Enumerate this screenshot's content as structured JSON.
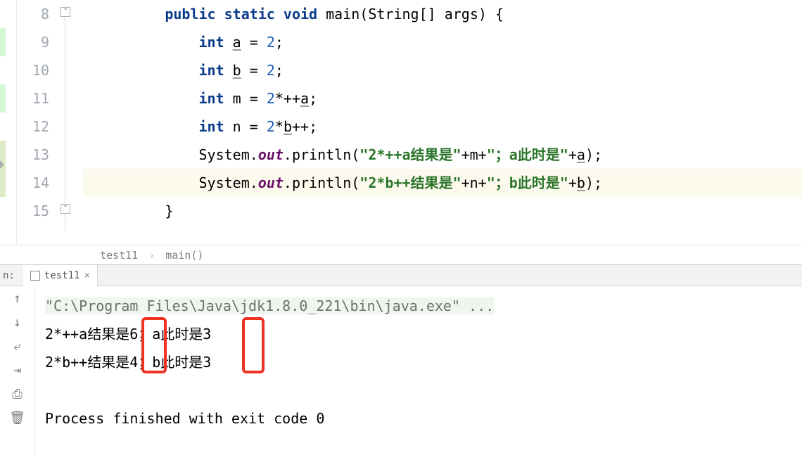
{
  "editor": {
    "lines": [
      {
        "n": 8,
        "indent": "        ",
        "tokens": [
          [
            "kw",
            "public"
          ],
          [
            "",
            " "
          ],
          [
            "kw",
            "static"
          ],
          [
            "",
            " "
          ],
          [
            "kw",
            "void"
          ],
          [
            "",
            " "
          ],
          [
            "",
            "main(String[] args) {"
          ]
        ]
      },
      {
        "n": 9,
        "indent": "            ",
        "tokens": [
          [
            "kw",
            "int"
          ],
          [
            "",
            " "
          ],
          [
            "und",
            "a"
          ],
          [
            "",
            " = "
          ],
          [
            "num",
            "2"
          ],
          [
            "",
            ";"
          ]
        ]
      },
      {
        "n": 10,
        "indent": "            ",
        "tokens": [
          [
            "kw",
            "int"
          ],
          [
            "",
            " "
          ],
          [
            "und",
            "b"
          ],
          [
            "",
            " = "
          ],
          [
            "num",
            "2"
          ],
          [
            "",
            ";"
          ]
        ]
      },
      {
        "n": 11,
        "indent": "            ",
        "tokens": [
          [
            "kw",
            "int"
          ],
          [
            "",
            " m = "
          ],
          [
            "num",
            "2"
          ],
          [
            "",
            "*++"
          ],
          [
            "und",
            "a"
          ],
          [
            "",
            ";"
          ]
        ]
      },
      {
        "n": 12,
        "indent": "            ",
        "tokens": [
          [
            "kw",
            "int"
          ],
          [
            "",
            " n = "
          ],
          [
            "num",
            "2"
          ],
          [
            "",
            "*"
          ],
          [
            "und",
            "b"
          ],
          [
            "",
            "++;"
          ]
        ]
      },
      {
        "n": 13,
        "indent": "            ",
        "tokens": [
          [
            "",
            "System."
          ],
          [
            "oi",
            "out"
          ],
          [
            "",
            ".println("
          ],
          [
            "str",
            "\"2*++a结果是\""
          ],
          [
            "",
            "+m+"
          ],
          [
            "str",
            "\"；a此时是\""
          ],
          [
            "",
            "+"
          ],
          [
            "und",
            "a"
          ],
          [
            "",
            ");"
          ]
        ]
      },
      {
        "n": 14,
        "indent": "            ",
        "tokens": [
          [
            "",
            "System."
          ],
          [
            "oi",
            "out"
          ],
          [
            "",
            ".println("
          ],
          [
            "str",
            "\"2*b++结果是\""
          ],
          [
            "",
            "+n+"
          ],
          [
            "str",
            "\"；b此时是\""
          ],
          [
            "",
            "+"
          ],
          [
            "und",
            "b"
          ],
          [
            "",
            ");"
          ]
        ],
        "current": true
      },
      {
        "n": 15,
        "indent": "        ",
        "tokens": [
          [
            "",
            "}"
          ]
        ]
      }
    ]
  },
  "breadcrumb": {
    "class": "test11",
    "method": "main()"
  },
  "run": {
    "label": "n:",
    "tab": "test11",
    "command": "\"C:\\Program Files\\Java\\jdk1.8.0_221\\bin\\java.exe\" ...",
    "out1": "2*++a结果是6；a此时是3",
    "out2": "2*b++结果是4；b此时是3",
    "exit": "Process finished with exit code 0"
  }
}
